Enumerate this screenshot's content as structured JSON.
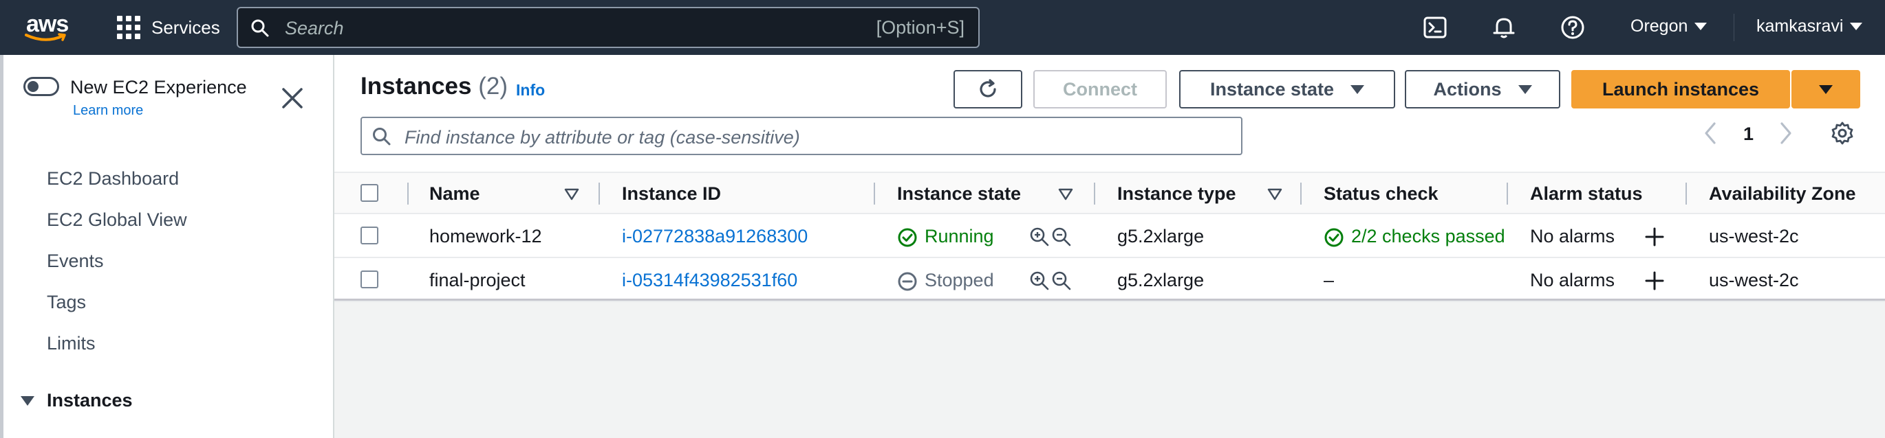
{
  "topnav": {
    "logo_text": "aws",
    "services_label": "Services",
    "search_placeholder": "Search",
    "search_shortcut": "[Option+S]",
    "region": "Oregon",
    "account": "kamkasravi",
    "icons": [
      "cloudshell-icon",
      "bell-icon",
      "help-icon"
    ]
  },
  "sidebar": {
    "new_experience_label": "New EC2 Experience",
    "learn_more": "Learn more",
    "items": [
      {
        "label": "EC2 Dashboard"
      },
      {
        "label": "EC2 Global View"
      },
      {
        "label": "Events"
      },
      {
        "label": "Tags"
      },
      {
        "label": "Limits"
      }
    ],
    "section": "Instances"
  },
  "main": {
    "title": "Instances",
    "count": "(2)",
    "info": "Info",
    "buttons": {
      "connect": "Connect",
      "instance_state": "Instance state",
      "actions": "Actions",
      "launch": "Launch instances"
    },
    "filter_placeholder": "Find instance by attribute or tag (case-sensitive)",
    "page": "1",
    "table": {
      "columns": [
        "Name",
        "Instance ID",
        "Instance state",
        "Instance type",
        "Status check",
        "Alarm status",
        "Availability Zone"
      ],
      "rows": [
        {
          "name": "homework-12",
          "id": "i-02772838a91268300",
          "state": "Running",
          "type": "g5.2xlarge",
          "status": "2/2 checks passed",
          "alarm": "No alarms",
          "zone": "us-west-2c"
        },
        {
          "name": "final-project",
          "id": "i-05314f43982531f60",
          "state": "Stopped",
          "type": "g5.2xlarge",
          "status": "–",
          "alarm": "No alarms",
          "zone": "us-west-2c"
        }
      ]
    }
  },
  "colors": {
    "nav_bg": "#232f3e",
    "primary": "#f4a033",
    "link": "#0972d3",
    "running": "#037f0c",
    "stopped": "#5f6b7a"
  }
}
